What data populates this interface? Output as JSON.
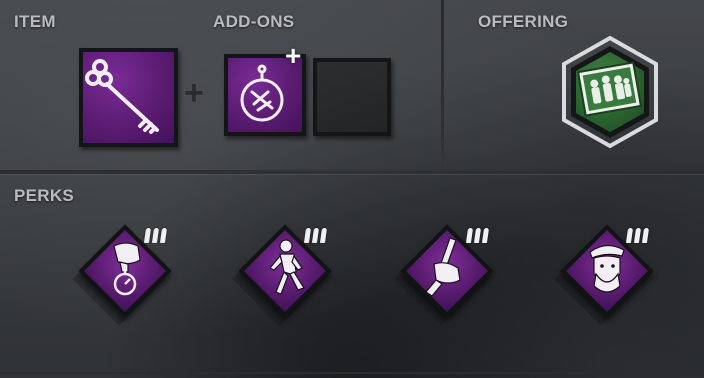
{
  "sections": {
    "item": {
      "label": "ITEM"
    },
    "addons": {
      "label": "ADD-ONS"
    },
    "offering": {
      "label": "OFFERING"
    },
    "perks": {
      "label": "PERKS"
    }
  },
  "item": {
    "icon": "skeleton-key-icon"
  },
  "addons": [
    {
      "icon": "pocket-watch-addon-icon",
      "state": "filled"
    },
    {
      "icon": "",
      "state": "empty"
    }
  ],
  "offering": {
    "icon": "photograph-offering-icon",
    "color": "#2e6b34"
  },
  "perks": [
    {
      "icon": "hand-holding-stopwatch-icon",
      "tier": 3
    },
    {
      "icon": "running-figure-icon",
      "tier": 3
    },
    {
      "icon": "hand-holding-knife-icon",
      "tier": 3
    },
    {
      "icon": "bearded-man-beret-icon",
      "tier": 3
    }
  ],
  "colors": {
    "rarity_purple": "#6a2384",
    "offering_green": "#2e6b34",
    "label_gray": "#b9bcc0"
  }
}
